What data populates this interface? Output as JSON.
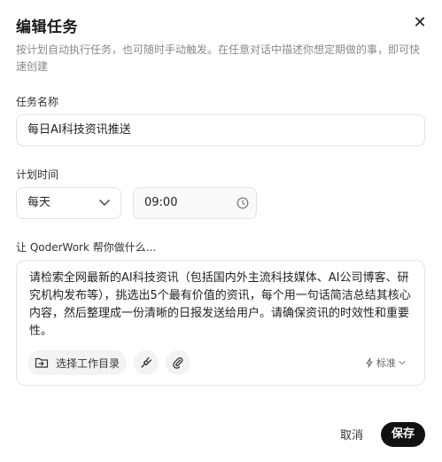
{
  "dialog": {
    "title": "编辑任务",
    "description": "按计划自动执行任务，也可随时手动触发。在任意对话中描述你想定期做的事，即可快速创建"
  },
  "task_name": {
    "label": "任务名称",
    "value": "每日AI科技资讯推送"
  },
  "schedule": {
    "label": "计划时间",
    "frequency": "每天",
    "time": "09:00"
  },
  "prompt": {
    "label": "让 QoderWork 帮你做什么...",
    "value": "请检索全网最新的AI科技资讯（包括国内外主流科技媒体、AI公司博客、研究机构发布等），挑选出5个最有价值的资讯，每个用一句话简洁总结其核心内容，然后整理成一份清晰的日报发送给用户。请确保资讯的时效性和重要性。",
    "folder_button": "选择工作目录",
    "quality": "标准"
  },
  "actions": {
    "cancel": "取消",
    "save": "保存"
  },
  "icons": {
    "close": "close-icon",
    "dropdown": "chevron-down-icon",
    "clock": "clock-icon",
    "folder": "folder-arrow-icon",
    "plugin": "plug-icon",
    "attach": "paperclip-icon",
    "bolt": "lightning-icon"
  }
}
